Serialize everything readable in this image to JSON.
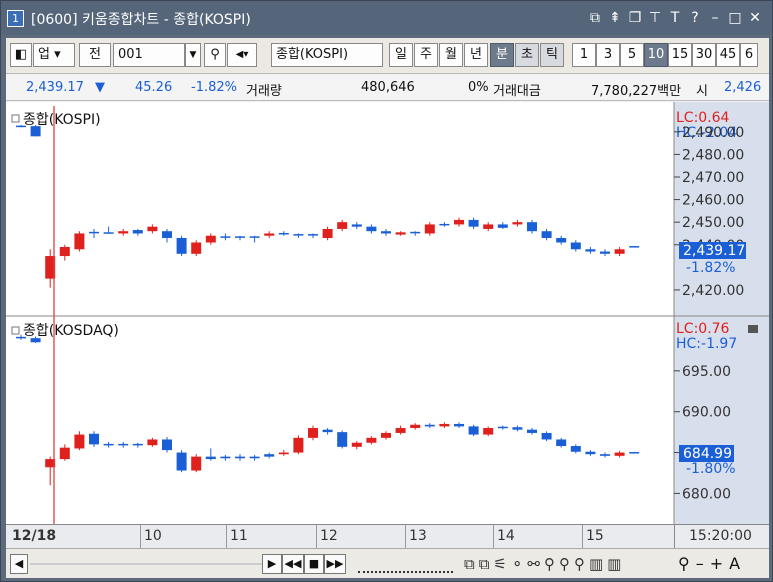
{
  "window": {
    "number": "1",
    "title": "[0600] 키움종합차트 - 종합(KOSPI)"
  },
  "toolbar": {
    "market": "업",
    "all": "전",
    "code": "001",
    "name": "종합(KOSPI)",
    "periods": [
      "일",
      "주",
      "월",
      "년",
      "분",
      "초",
      "틱"
    ],
    "minutes": [
      "1",
      "3",
      "5",
      "10",
      "15",
      "30",
      "45",
      "6"
    ],
    "selected_period": "분",
    "selected_minute": "10"
  },
  "quote": {
    "price": "2,439.17",
    "change": "45.26",
    "pct": "-1.82%",
    "vol_label": "거래량",
    "volume": "480,646",
    "vol_pct": "0%",
    "amt_label": "거래대금",
    "amount": "7,780,227백만",
    "open_label": "시",
    "open": "2,426"
  },
  "panel1": {
    "title": "종합(KOSPI)",
    "lc": "LC:0.64",
    "hc": "HC:-2.04",
    "last_price": "2,439.17",
    "last_pct": "-1.82%"
  },
  "panel2": {
    "title": "종합(KOSDAQ)",
    "lc": "LC:0.76",
    "hc": "HC:-1.97",
    "last_price": "684.99",
    "last_pct": "-1.80%"
  },
  "x_axis": {
    "date": "12/18",
    "ticks": [
      "10",
      "11",
      "12",
      "13",
      "14",
      "15"
    ],
    "time": "15:20:00"
  },
  "chart_data": [
    {
      "type": "candlestick",
      "title": "종합(KOSPI)",
      "y_ticks": [
        2420,
        2440,
        2450,
        2460,
        2470,
        2480,
        2490
      ],
      "y_tick_labels": [
        "2,420.00",
        "2,440.00",
        "2,450.00",
        "2,460.00",
        "2,470.00",
        "2,480.00",
        "2,490.00"
      ],
      "ylim": [
        2412,
        2497
      ],
      "candles": [
        {
          "o": 2492.5,
          "c": 2492.5,
          "h": 2493,
          "l": 2492,
          "d": 0
        },
        {
          "o": 2492.5,
          "c": 2488,
          "h": 2493,
          "l": 2488,
          "d": -1
        },
        {
          "o": 2425,
          "c": 2435,
          "h": 2438,
          "l": 2421,
          "d": 1
        },
        {
          "o": 2435,
          "c": 2439,
          "h": 2440,
          "l": 2433,
          "d": 1
        },
        {
          "o": 2438,
          "c": 2445,
          "h": 2446,
          "l": 2437,
          "d": 1
        },
        {
          "o": 2445,
          "c": 2445.5,
          "h": 2447,
          "l": 2443,
          "d": 0
        },
        {
          "o": 2445.3,
          "c": 2445.3,
          "h": 2448,
          "l": 2445,
          "d": 0
        },
        {
          "o": 2445,
          "c": 2446,
          "h": 2447,
          "l": 2444,
          "d": 1
        },
        {
          "o": 2446.5,
          "c": 2445,
          "h": 2447,
          "l": 2444,
          "d": -1
        },
        {
          "o": 2446,
          "c": 2448,
          "h": 2449,
          "l": 2445,
          "d": 1
        },
        {
          "o": 2446,
          "c": 2443,
          "h": 2447,
          "l": 2441,
          "d": -1
        },
        {
          "o": 2443,
          "c": 2436,
          "h": 2444,
          "l": 2435,
          "d": -1
        },
        {
          "o": 2436,
          "c": 2441,
          "h": 2442,
          "l": 2435,
          "d": 1
        },
        {
          "o": 2441,
          "c": 2444,
          "h": 2445,
          "l": 2440,
          "d": 1
        },
        {
          "o": 2443,
          "c": 2443.5,
          "h": 2445,
          "l": 2442,
          "d": 0
        },
        {
          "o": 2443,
          "c": 2443.5,
          "h": 2444,
          "l": 2442,
          "d": 0
        },
        {
          "o": 2443,
          "c": 2443.5,
          "h": 2444,
          "l": 2441,
          "d": 0
        },
        {
          "o": 2444,
          "c": 2445,
          "h": 2446,
          "l": 2443,
          "d": 1
        },
        {
          "o": 2445,
          "c": 2444.5,
          "h": 2446,
          "l": 2444,
          "d": -1
        },
        {
          "o": 2444.5,
          "c": 2444,
          "h": 2445,
          "l": 2443,
          "d": -1
        },
        {
          "o": 2444,
          "c": 2444.5,
          "h": 2445,
          "l": 2443,
          "d": 0
        },
        {
          "o": 2443,
          "c": 2447,
          "h": 2448,
          "l": 2442,
          "d": 1
        },
        {
          "o": 2447,
          "c": 2450,
          "h": 2451,
          "l": 2446,
          "d": 1
        },
        {
          "o": 2449,
          "c": 2448,
          "h": 2450,
          "l": 2447,
          "d": -1
        },
        {
          "o": 2448,
          "c": 2446,
          "h": 2449,
          "l": 2445,
          "d": -1
        },
        {
          "o": 2446,
          "c": 2445,
          "h": 2447,
          "l": 2444,
          "d": -1
        },
        {
          "o": 2444.5,
          "c": 2445.5,
          "h": 2446,
          "l": 2444,
          "d": 1
        },
        {
          "o": 2445,
          "c": 2445.5,
          "h": 2446,
          "l": 2444,
          "d": 0
        },
        {
          "o": 2445,
          "c": 2449,
          "h": 2450,
          "l": 2444,
          "d": 1
        },
        {
          "o": 2449,
          "c": 2449,
          "h": 2450,
          "l": 2448,
          "d": 0
        },
        {
          "o": 2449,
          "c": 2451,
          "h": 2452,
          "l": 2448,
          "d": 1
        },
        {
          "o": 2451,
          "c": 2448,
          "h": 2452,
          "l": 2447,
          "d": -1
        },
        {
          "o": 2447,
          "c": 2449,
          "h": 2450,
          "l": 2446,
          "d": 1
        },
        {
          "o": 2449,
          "c": 2447.5,
          "h": 2450,
          "l": 2447,
          "d": 0
        },
        {
          "o": 2449,
          "c": 2450,
          "h": 2451,
          "l": 2448,
          "d": 1
        },
        {
          "o": 2450,
          "c": 2446,
          "h": 2451,
          "l": 2445,
          "d": -1
        },
        {
          "o": 2446,
          "c": 2443,
          "h": 2447,
          "l": 2442,
          "d": -1
        },
        {
          "o": 2443,
          "c": 2441,
          "h": 2444,
          "l": 2440,
          "d": -1
        },
        {
          "o": 2441,
          "c": 2438,
          "h": 2442,
          "l": 2437,
          "d": -1
        },
        {
          "o": 2438,
          "c": 2437,
          "h": 2439,
          "l": 2436,
          "d": -1
        },
        {
          "o": 2437,
          "c": 2436,
          "h": 2438,
          "l": 2435,
          "d": -1
        },
        {
          "o": 2436,
          "c": 2438,
          "h": 2439,
          "l": 2435,
          "d": 1
        },
        {
          "o": 2439,
          "c": 2439.2,
          "h": 2439.5,
          "l": 2438.8,
          "d": 0
        }
      ]
    },
    {
      "type": "candlestick",
      "title": "종합(KOSDAQ)",
      "y_ticks": [
        680,
        685,
        690,
        695
      ],
      "y_tick_labels": [
        "680.00",
        "685.00",
        "690.00",
        "695.00"
      ],
      "ylim": [
        676.5,
        700
      ],
      "candles": [
        {
          "o": 699.1,
          "c": 699.1,
          "h": 699.4,
          "l": 698.8,
          "d": -1
        },
        {
          "o": 699,
          "c": 698.5,
          "h": 699.2,
          "l": 698.4,
          "d": -1
        },
        {
          "o": 683.2,
          "c": 684.2,
          "h": 684.5,
          "l": 681.0,
          "d": 1
        },
        {
          "o": 684.2,
          "c": 685.6,
          "h": 686.0,
          "l": 684.0,
          "d": 1
        },
        {
          "o": 685.5,
          "c": 687.2,
          "h": 687.6,
          "l": 685.3,
          "d": 1
        },
        {
          "o": 687.3,
          "c": 686.0,
          "h": 687.6,
          "l": 685.7,
          "d": -1
        },
        {
          "o": 685.9,
          "c": 686.0,
          "h": 686.3,
          "l": 685.6,
          "d": 0
        },
        {
          "o": 685.9,
          "c": 686.0,
          "h": 686.3,
          "l": 685.6,
          "d": 0
        },
        {
          "o": 685.9,
          "c": 686.0,
          "h": 686.2,
          "l": 685.6,
          "d": 0
        },
        {
          "o": 685.9,
          "c": 686.6,
          "h": 686.8,
          "l": 685.7,
          "d": 1
        },
        {
          "o": 686.6,
          "c": 685.3,
          "h": 686.9,
          "l": 685.0,
          "d": -1
        },
        {
          "o": 685.0,
          "c": 682.8,
          "h": 685.3,
          "l": 682.6,
          "d": -1
        },
        {
          "o": 682.8,
          "c": 684.5,
          "h": 684.8,
          "l": 682.6,
          "d": 1
        },
        {
          "o": 684.2,
          "c": 684.5,
          "h": 685.5,
          "l": 684.0,
          "d": 0
        },
        {
          "o": 684.5,
          "c": 684.3,
          "h": 684.7,
          "l": 684.0,
          "d": -1
        },
        {
          "o": 684.3,
          "c": 684.5,
          "h": 684.8,
          "l": 684.0,
          "d": 0
        },
        {
          "o": 684.5,
          "c": 684.3,
          "h": 684.7,
          "l": 684.0,
          "d": -1
        },
        {
          "o": 684.5,
          "c": 684.8,
          "h": 685.0,
          "l": 684.3,
          "d": 0
        },
        {
          "o": 684.8,
          "c": 685.0,
          "h": 685.3,
          "l": 684.6,
          "d": 1
        },
        {
          "o": 685.0,
          "c": 686.8,
          "h": 687.1,
          "l": 684.8,
          "d": 1
        },
        {
          "o": 686.8,
          "c": 688.0,
          "h": 688.3,
          "l": 686.5,
          "d": 1
        },
        {
          "o": 687.8,
          "c": 687.5,
          "h": 688.0,
          "l": 687.2,
          "d": -1
        },
        {
          "o": 687.5,
          "c": 685.7,
          "h": 687.7,
          "l": 685.5,
          "d": -1
        },
        {
          "o": 685.7,
          "c": 686.2,
          "h": 686.4,
          "l": 685.4,
          "d": 1
        },
        {
          "o": 686.2,
          "c": 686.8,
          "h": 687.0,
          "l": 686.0,
          "d": 1
        },
        {
          "o": 686.8,
          "c": 687.4,
          "h": 687.6,
          "l": 686.6,
          "d": 1
        },
        {
          "o": 687.4,
          "c": 688.0,
          "h": 688.3,
          "l": 687.2,
          "d": 1
        },
        {
          "o": 688.0,
          "c": 688.4,
          "h": 688.6,
          "l": 687.8,
          "d": 1
        },
        {
          "o": 688.4,
          "c": 688.2,
          "h": 688.6,
          "l": 688.0,
          "d": -1
        },
        {
          "o": 688.2,
          "c": 688.5,
          "h": 688.7,
          "l": 688.0,
          "d": 1
        },
        {
          "o": 688.5,
          "c": 688.2,
          "h": 688.7,
          "l": 688.0,
          "d": 0
        },
        {
          "o": 688.2,
          "c": 687.2,
          "h": 688.4,
          "l": 687.0,
          "d": -1
        },
        {
          "o": 687.2,
          "c": 688.0,
          "h": 688.2,
          "l": 687.0,
          "d": 1
        },
        {
          "o": 688.0,
          "c": 688.1,
          "h": 688.3,
          "l": 687.8,
          "d": 0
        },
        {
          "o": 688.1,
          "c": 687.8,
          "h": 688.3,
          "l": 687.6,
          "d": -1
        },
        {
          "o": 687.8,
          "c": 687.4,
          "h": 688.0,
          "l": 687.2,
          "d": -1
        },
        {
          "o": 687.4,
          "c": 686.6,
          "h": 687.6,
          "l": 686.4,
          "d": -1
        },
        {
          "o": 686.6,
          "c": 685.8,
          "h": 686.8,
          "l": 685.6,
          "d": -1
        },
        {
          "o": 685.8,
          "c": 685.1,
          "h": 686.0,
          "l": 684.9,
          "d": -1
        },
        {
          "o": 685.1,
          "c": 684.8,
          "h": 685.3,
          "l": 684.6,
          "d": -1
        },
        {
          "o": 684.8,
          "c": 684.6,
          "h": 685.0,
          "l": 684.4,
          "d": 0
        },
        {
          "o": 684.6,
          "c": 685.0,
          "h": 685.2,
          "l": 684.4,
          "d": 1
        },
        {
          "o": 685.0,
          "c": 685.0,
          "h": 685.1,
          "l": 684.9,
          "d": 0
        }
      ]
    }
  ]
}
